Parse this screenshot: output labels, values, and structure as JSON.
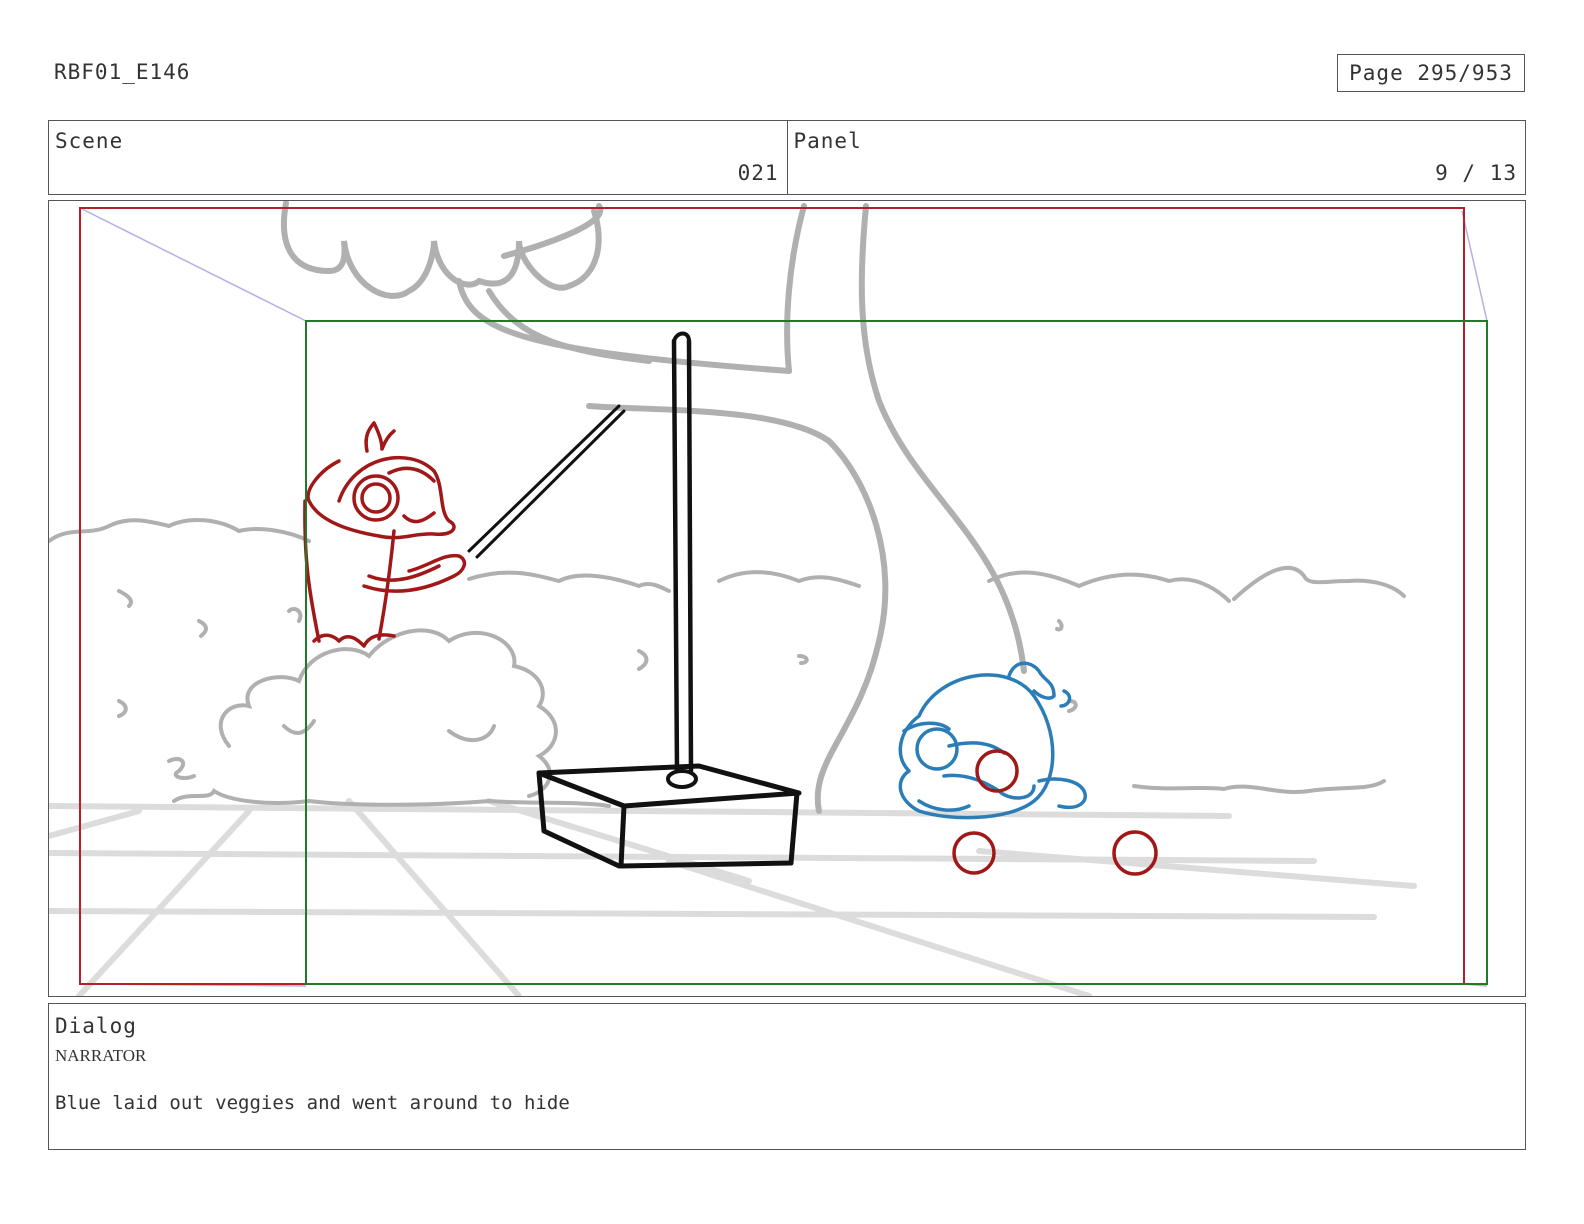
{
  "document": {
    "id": "RBF01_E146",
    "page": "Page 295/953"
  },
  "header": {
    "scene_label": "Scene",
    "scene_value": "021",
    "panel_label": "Panel",
    "panel_value": "9 / 13"
  },
  "dialog": {
    "label": "Dialog",
    "speaker": "NARRATOR",
    "line": "Blue laid out veggies and went around to hide"
  },
  "colors": {
    "safe_frame": "#b32025",
    "camera_frame": "#1f7a2a",
    "red_bird": "#a01818",
    "blue_bird": "#2b7db8",
    "sketch_gray": "#b0b0b0",
    "ink": "#111111"
  }
}
